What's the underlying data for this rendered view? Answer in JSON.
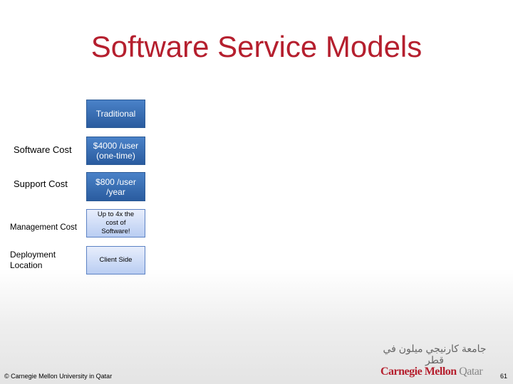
{
  "title": "Software Service Models",
  "column_header": "Traditional",
  "rows": [
    {
      "label": "Software Cost",
      "value": "$4000 /user (one-time)"
    },
    {
      "label": "Support Cost",
      "value": "$800 /user /year"
    },
    {
      "label": "Management Cost",
      "value": "Up to 4x the cost of Software!"
    },
    {
      "label": "Deployment Location",
      "value": "Client Side"
    }
  ],
  "footer": "© Carnegie Mellon University in Qatar",
  "page_number": "61",
  "logo": {
    "arabic": "جامعة كارنيجي ميلون في قطر",
    "name": "Carnegie Mellon",
    "suffix": "Qatar"
  }
}
